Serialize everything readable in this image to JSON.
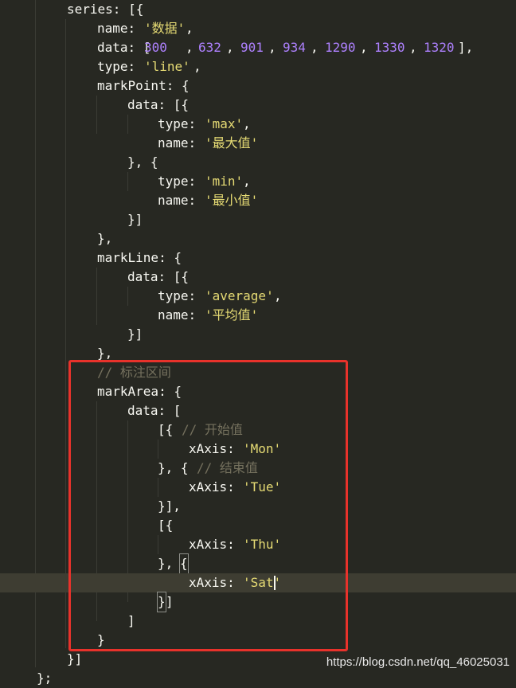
{
  "editor": {
    "lines": [
      {
        "tokens": [
          {
            "t": "series: [{",
            "k": "p"
          }
        ]
      },
      {
        "tokens": [
          {
            "t": "name: ",
            "k": "p"
          },
          {
            "t": "'数据'",
            "k": "s"
          },
          {
            "t": ",",
            "k": "p"
          }
        ]
      },
      {
        "tokens": [
          {
            "t": "data: [",
            "k": "p"
          },
          {
            "t": "300",
            "k": "n"
          },
          {
            "t": ", ",
            "k": "p"
          },
          {
            "t": "632",
            "k": "n"
          },
          {
            "t": ", ",
            "k": "p"
          },
          {
            "t": "901",
            "k": "n"
          },
          {
            "t": ", ",
            "k": "p"
          },
          {
            "t": "934",
            "k": "n"
          },
          {
            "t": ", ",
            "k": "p"
          },
          {
            "t": "1290",
            "k": "n"
          },
          {
            "t": ", ",
            "k": "p"
          },
          {
            "t": "1330",
            "k": "n"
          },
          {
            "t": ", ",
            "k": "p"
          },
          {
            "t": "1320",
            "k": "n"
          },
          {
            "t": "],",
            "k": "p"
          }
        ]
      },
      {
        "tokens": [
          {
            "t": "type: ",
            "k": "p"
          },
          {
            "t": "'line'",
            "k": "s"
          },
          {
            "t": ",",
            "k": "p"
          }
        ]
      },
      {
        "tokens": [
          {
            "t": "markPoint: {",
            "k": "p"
          }
        ]
      },
      {
        "tokens": [
          {
            "t": "data: [{",
            "k": "p"
          }
        ]
      },
      {
        "tokens": [
          {
            "t": "type: ",
            "k": "p"
          },
          {
            "t": "'max'",
            "k": "s"
          },
          {
            "t": ",",
            "k": "p"
          }
        ]
      },
      {
        "tokens": [
          {
            "t": "name: ",
            "k": "p"
          },
          {
            "t": "'最大值'",
            "k": "s"
          }
        ]
      },
      {
        "tokens": [
          {
            "t": "}, {",
            "k": "p"
          }
        ]
      },
      {
        "tokens": [
          {
            "t": "type: ",
            "k": "p"
          },
          {
            "t": "'min'",
            "k": "s"
          },
          {
            "t": ",",
            "k": "p"
          }
        ]
      },
      {
        "tokens": [
          {
            "t": "name: ",
            "k": "p"
          },
          {
            "t": "'最小值'",
            "k": "s"
          }
        ]
      },
      {
        "tokens": [
          {
            "t": "}]",
            "k": "p"
          }
        ]
      },
      {
        "tokens": [
          {
            "t": "},",
            "k": "p"
          }
        ]
      },
      {
        "tokens": [
          {
            "t": "markLine: {",
            "k": "p"
          }
        ]
      },
      {
        "tokens": [
          {
            "t": "data: [{",
            "k": "p"
          }
        ]
      },
      {
        "tokens": [
          {
            "t": "type: ",
            "k": "p"
          },
          {
            "t": "'average'",
            "k": "s"
          },
          {
            "t": ",",
            "k": "p"
          }
        ]
      },
      {
        "tokens": [
          {
            "t": "name: ",
            "k": "p"
          },
          {
            "t": "'平均值'",
            "k": "s"
          }
        ]
      },
      {
        "tokens": [
          {
            "t": "}]",
            "k": "p"
          }
        ]
      },
      {
        "tokens": [
          {
            "t": "},",
            "k": "p"
          }
        ]
      },
      {
        "tokens": [
          {
            "t": "// 标注区间",
            "k": "c"
          }
        ]
      },
      {
        "tokens": [
          {
            "t": "markArea: {",
            "k": "p"
          }
        ]
      },
      {
        "tokens": [
          {
            "t": "data: [",
            "k": "p"
          }
        ]
      },
      {
        "tokens": [
          {
            "t": "[{ ",
            "k": "p"
          },
          {
            "t": "// 开始值",
            "k": "c"
          }
        ]
      },
      {
        "tokens": [
          {
            "t": "xAxis: ",
            "k": "p"
          },
          {
            "t": "'Mon'",
            "k": "s"
          }
        ]
      },
      {
        "tokens": [
          {
            "t": "}, { ",
            "k": "p"
          },
          {
            "t": "// 结束值",
            "k": "c"
          }
        ]
      },
      {
        "tokens": [
          {
            "t": "xAxis: ",
            "k": "p"
          },
          {
            "t": "'Tue'",
            "k": "s"
          }
        ]
      },
      {
        "tokens": [
          {
            "t": "}],",
            "k": "p"
          }
        ]
      },
      {
        "tokens": [
          {
            "t": "[{",
            "k": "p"
          }
        ]
      },
      {
        "tokens": [
          {
            "t": "xAxis: ",
            "k": "p"
          },
          {
            "t": "'Thu'",
            "k": "s"
          }
        ]
      },
      {
        "tokens": [
          {
            "t": "}, ",
            "k": "p"
          },
          {
            "t": "{",
            "k": "p",
            "m": true
          }
        ]
      },
      {
        "tokens": [
          {
            "t": "xAxis: ",
            "k": "p"
          },
          {
            "t": "'Sat'",
            "k": "s"
          }
        ],
        "active": true,
        "caret": true
      },
      {
        "tokens": [
          {
            "t": "}",
            "k": "p",
            "m": true
          },
          {
            "t": "]",
            "k": "p"
          }
        ]
      },
      {
        "tokens": [
          {
            "t": "]",
            "k": "p"
          }
        ]
      },
      {
        "tokens": [
          {
            "t": "}",
            "k": "p"
          }
        ]
      },
      {
        "tokens": [
          {
            "t": "}]",
            "k": "p"
          }
        ]
      },
      {
        "tokens": [
          {
            "t": "};",
            "k": "p"
          }
        ]
      }
    ]
  },
  "watermark": "https://blog.csdn.net/qq_46025031",
  "colors": {
    "background": "#272822",
    "text": "#f8f8f2",
    "string": "#e6db74",
    "number": "#ae81ff",
    "comment": "#75715e",
    "highlight_border": "#e8322b"
  }
}
